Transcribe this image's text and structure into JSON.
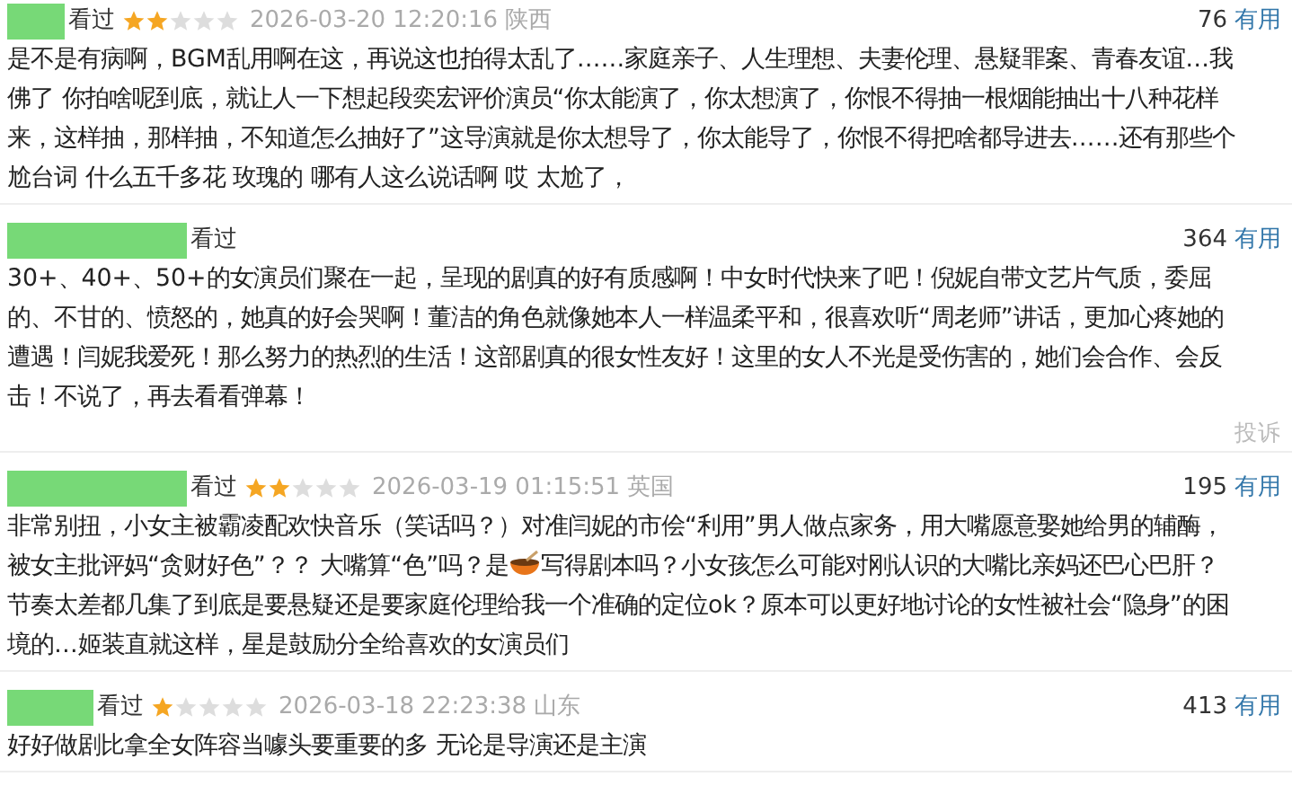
{
  "reviews": [
    {
      "status": "看过",
      "stars": 2,
      "time": "2026-03-20 12:20:16",
      "location": "陕西",
      "votes": "76",
      "useful": "有用",
      "body": [
        {
          "kind": "text",
          "text": "是不是有病啊，BGM乱用啊在这，再说这也拍得太乱了……家庭亲子、人生理想、夫妻伦理、悬疑罪案、青春友谊…我佛了 你拍啥呢到底，就让人一下想起段奕宏评价演员“你太能演了，你太想演了，你恨不得抽一根烟能抽出十八种花样来，这样抽，那样抽，不知道怎么抽好了”这导演就是你太想导了，你太能导了，你恨不得把啥都导进去……还有那些个尬台词 什么五千多花 玫瑰的 哪有人这么说话啊 哎 太尬了，"
        }
      ]
    },
    {
      "status": "看过",
      "votes": "364",
      "useful": "有用",
      "report": "投诉",
      "body": [
        {
          "kind": "text",
          "text": "30+、40+、50+的女演员们聚在一起，呈现的剧真的好有质感啊！中女时代快来了吧！倪妮自带文艺片气质，委屈的、不甘的、愤怒的，她真的好会哭啊！董洁的角色就像她本人一样温柔平和，很喜欢听“周老师”讲话，更加心疼她的遭遇！闫妮我爱死！那么努力的热烈的生活！这部剧真的很女性友好！这里的女人不光是受伤害的，她们会合作、会反击！不说了，再去看看弹幕！"
        }
      ]
    },
    {
      "status": "看过",
      "stars": 2,
      "time": "2026-03-19 01:15:51",
      "location": "英国",
      "votes": "195",
      "useful": "有用",
      "body": [
        {
          "kind": "text",
          "text": "非常别扭，小女主被霸凌配欢快音乐（笑话吗？）对准闫妮的市侩“利用”男人做点家务，用大嘴愿意娶她给男的辅酶，被女主批评妈“贪财好色”？？ 大嘴算“色”吗？是"
        },
        {
          "kind": "icon"
        },
        {
          "kind": "text",
          "text": "写得剧本吗？小女孩怎么可能对刚认识的大嘴比亲妈还巴心巴肝？节奏太差都几集了到底是要悬疑还是要家庭伦理给我一个准确的定位ok？原本可以更好地讨论的女性被社会“隐身”的困境的…姬装直就这样，星是鼓励分全给喜欢的女演员们"
        }
      ]
    },
    {
      "status": "看过",
      "stars": 1,
      "time": "2026-03-18 22:23:38",
      "location": "山东",
      "votes": "413",
      "useful": "有用",
      "body": [
        {
          "kind": "text",
          "text": "好好做剧比拿全女阵容当噱头要重要的多 无论是导演还是主演"
        }
      ]
    }
  ]
}
